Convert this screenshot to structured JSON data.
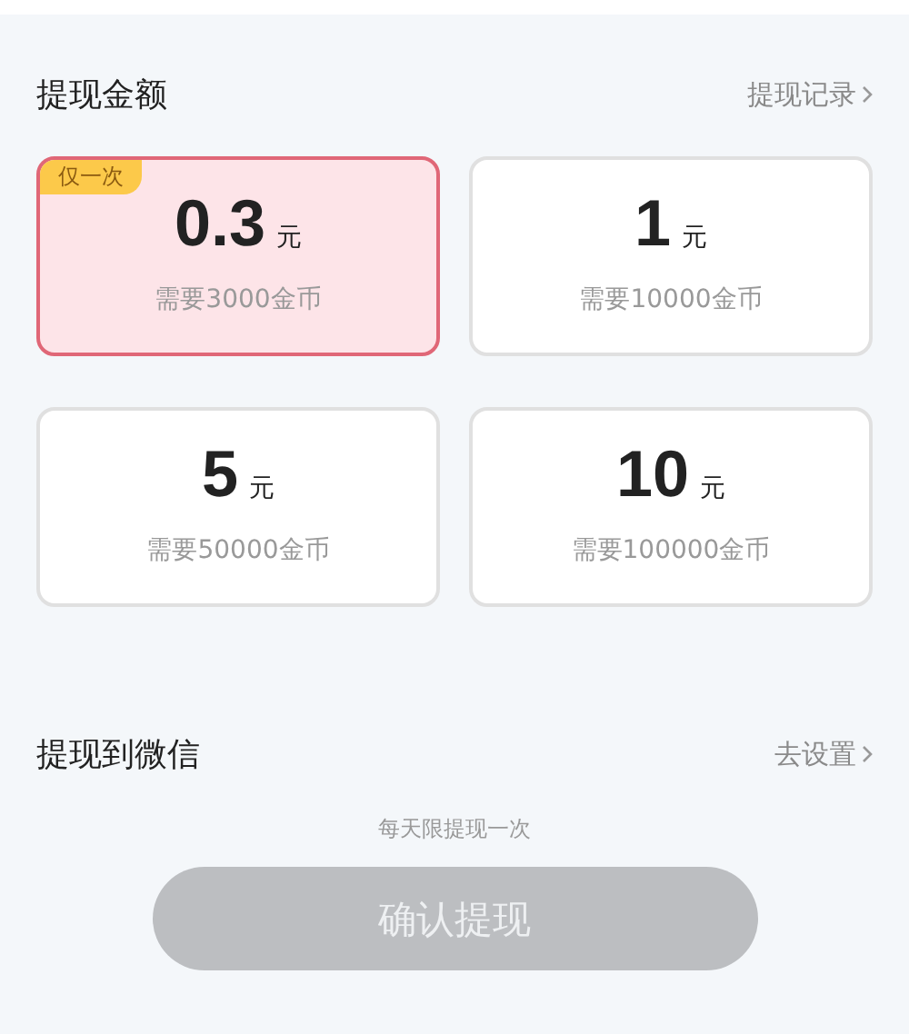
{
  "amount_section": {
    "title": "提现金额",
    "link": "提现记录"
  },
  "options": [
    {
      "amount": "0.3",
      "unit": "元",
      "requirement": "需要3000金币",
      "badge": "仅一次",
      "selected": true
    },
    {
      "amount": "1",
      "unit": "元",
      "requirement": "需要10000金币",
      "selected": false
    },
    {
      "amount": "5",
      "unit": "元",
      "requirement": "需要50000金币",
      "selected": false
    },
    {
      "amount": "10",
      "unit": "元",
      "requirement": "需要100000金币",
      "selected": false
    }
  ],
  "wechat_section": {
    "title": "提现到微信",
    "link": "去设置"
  },
  "note": "每天限提现一次",
  "confirm_button": {
    "label": "确认提现",
    "disabled": true
  }
}
